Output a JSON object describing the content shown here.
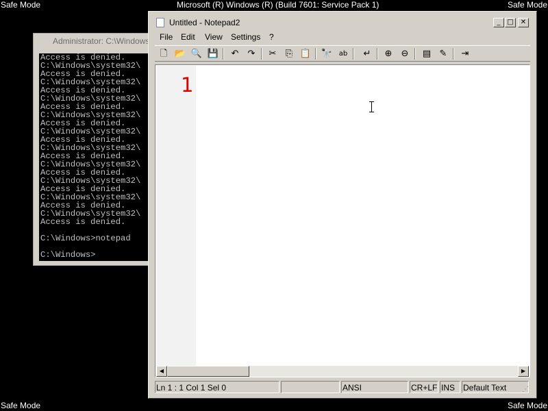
{
  "desktop": {
    "safe_mode_label": "Safe Mode",
    "os_banner": "Microsoft (R) Windows (R) (Build 7601: Service Pack 1)"
  },
  "console": {
    "title": "Administrator: C:\\Windows",
    "lines": [
      "Access is denied.",
      "C:\\Windows\\system32\\",
      "Access is denied.",
      "C:\\Windows\\system32\\",
      "Access is denied.",
      "C:\\Windows\\system32\\",
      "Access is denied.",
      "C:\\Windows\\system32\\",
      "Access is denied.",
      "C:\\Windows\\system32\\",
      "Access is denied.",
      "C:\\Windows\\system32\\",
      "Access is denied.",
      "C:\\Windows\\system32\\",
      "Access is denied.",
      "C:\\Windows\\system32\\",
      "Access is denied.",
      "C:\\Windows\\system32\\",
      "Access is denied.",
      "C:\\Windows\\system32\\",
      "Access is denied.",
      "",
      "C:\\Windows>notepad",
      "",
      "C:\\Windows>"
    ]
  },
  "notepad": {
    "title": "Untitled - Notepad2",
    "window_buttons": {
      "minimize": "_",
      "maximize": "□",
      "close": "✕"
    },
    "menu": [
      "File",
      "Edit",
      "View",
      "Settings",
      "?"
    ],
    "toolbar_icons": [
      {
        "name": "new-file-icon",
        "glyph": "🗋"
      },
      {
        "name": "open-folder-icon",
        "glyph": "📂"
      },
      {
        "name": "browse-icon",
        "glyph": "🔍"
      },
      {
        "name": "save-icon",
        "glyph": "💾"
      },
      {
        "name": "undo-icon",
        "glyph": "↶"
      },
      {
        "name": "redo-icon",
        "glyph": "↷"
      },
      {
        "name": "cut-icon",
        "glyph": "✂"
      },
      {
        "name": "copy-icon",
        "glyph": "⎘"
      },
      {
        "name": "paste-icon",
        "glyph": "📋"
      },
      {
        "name": "find-icon",
        "glyph": "🔭"
      },
      {
        "name": "replace-icon",
        "glyph": "ab"
      },
      {
        "name": "word-wrap-icon",
        "glyph": "↵"
      },
      {
        "name": "zoom-in-icon",
        "glyph": "⊕"
      },
      {
        "name": "zoom-out-icon",
        "glyph": "⊖"
      },
      {
        "name": "scheme-icon",
        "glyph": "▤"
      },
      {
        "name": "customize-scheme-icon",
        "glyph": "✎"
      },
      {
        "name": "exit-icon",
        "glyph": "⇥"
      }
    ],
    "editor": {
      "line_number": "1",
      "content": ""
    },
    "status": {
      "position": "Ln 1 : 1   Col 1   Sel 0",
      "size": "",
      "encoding": "ANSI",
      "line_endings": "CR+LF",
      "insert_mode": "INS",
      "scheme": "Default Text"
    },
    "accent_line_number_color": "#e00000"
  }
}
